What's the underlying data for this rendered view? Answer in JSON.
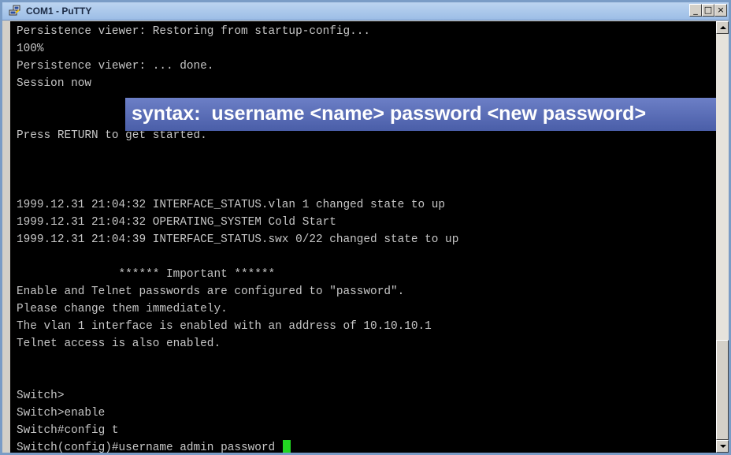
{
  "window": {
    "title": "COM1 - PuTTY",
    "icon": "putty-computer-icon",
    "controls": {
      "minimize": "_",
      "maximize": "□",
      "close": "×"
    }
  },
  "terminal": {
    "lines": [
      "Persistence viewer: Restoring from startup-config...",
      "100%",
      "Persistence viewer: ... done.",
      "Session now",
      "",
      "Press RETURN to get started.",
      "",
      "",
      "1999.12.31 21:04:32 INTERFACE_STATUS.vlan 1 changed state to up",
      "1999.12.31 21:04:32 OPERATING_SYSTEM Cold Start",
      "1999.12.31 21:04:39 INTERFACE_STATUS.swx 0/22 changed state to up",
      "",
      "               ****** Important ******",
      "Enable and Telnet passwords are configured to \"password\".",
      "Please change them immediately.",
      "The vlan 1 interface is enabled with an address of 10.10.10.1",
      "Telnet access is also enabled.",
      "",
      "",
      "Switch>",
      "Switch>enable",
      "Switch#config t",
      "Switch(config)#username admin password "
    ],
    "cursor_color": "#22d622",
    "text_color": "#c6c6c6",
    "background": "#000000"
  },
  "overlay": {
    "text": "syntax:  username <name> password <new password>"
  },
  "scrollbar": {
    "position": "bottom"
  }
}
